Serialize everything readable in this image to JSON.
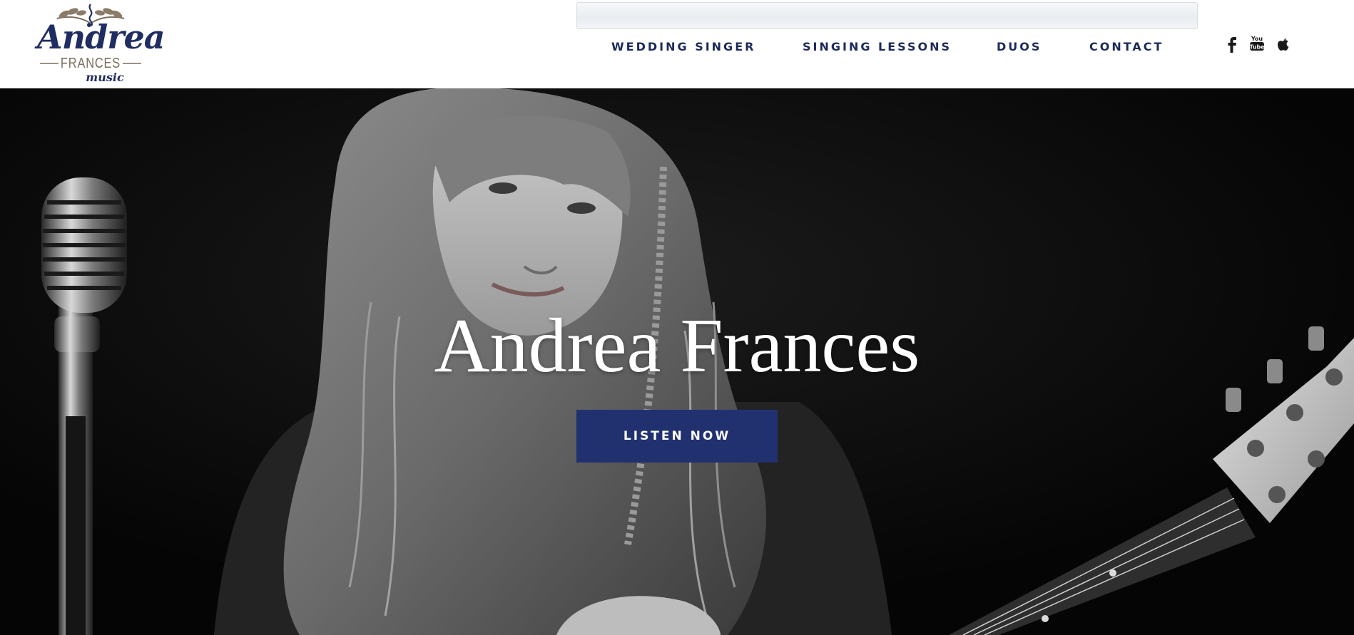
{
  "logo": {
    "name": "Andrea",
    "sub": "FRANCES",
    "tag": "music"
  },
  "search": {
    "placeholder": ""
  },
  "nav": {
    "items": [
      {
        "label": "WEDDING SINGER"
      },
      {
        "label": "SINGING LESSONS"
      },
      {
        "label": "DUOS"
      },
      {
        "label": "CONTACT"
      }
    ]
  },
  "social": {
    "icons": [
      "facebook-icon",
      "youtube-icon",
      "apple-icon"
    ],
    "youtube_text": "You Tube"
  },
  "hero": {
    "title": "Andrea Frances",
    "cta_label": "LISTEN NOW"
  },
  "colors": {
    "navy": "#213170",
    "nav_text": "#1c2a5a",
    "hero_bg": "#060606",
    "white": "#ffffff"
  }
}
